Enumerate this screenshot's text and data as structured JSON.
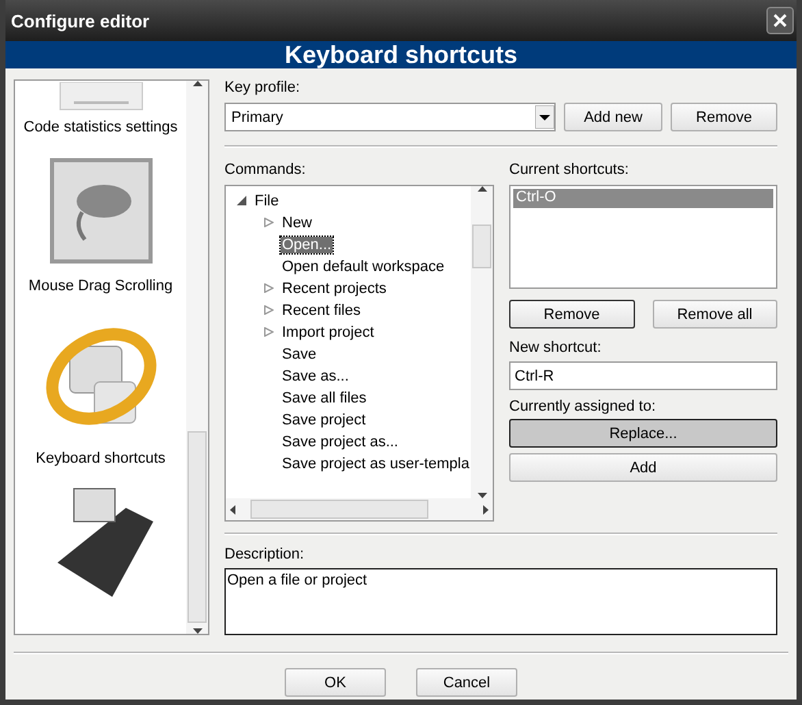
{
  "window": {
    "title": "Configure editor"
  },
  "header": "Keyboard shortcuts",
  "sidebar": {
    "items": [
      {
        "label": "Code statistics settings"
      },
      {
        "label": "Mouse Drag Scrolling"
      },
      {
        "label": "Keyboard shortcuts"
      }
    ]
  },
  "key_profile": {
    "label": "Key profile:",
    "value": "Primary",
    "buttons": [
      "Add new",
      "Remove"
    ]
  },
  "commands": {
    "label": "Commands:",
    "tree": [
      {
        "label": "File",
        "kind": "branch",
        "expanded": true,
        "selected": false,
        "children": [
          {
            "label": "New",
            "kind": "branch",
            "expanded": false,
            "selected": false
          },
          {
            "label": "Open...",
            "kind": "leaf",
            "selected": true
          },
          {
            "label": "Open default workspace",
            "kind": "leaf",
            "selected": false
          },
          {
            "label": "Recent projects",
            "kind": "branch",
            "expanded": false,
            "selected": false
          },
          {
            "label": "Recent files",
            "kind": "branch",
            "expanded": false,
            "selected": false
          },
          {
            "label": "Import project",
            "kind": "branch",
            "expanded": false,
            "selected": false
          },
          {
            "label": "Save",
            "kind": "leaf",
            "selected": false
          },
          {
            "label": "Save as...",
            "kind": "leaf",
            "selected": false
          },
          {
            "label": "Save all files",
            "kind": "leaf",
            "selected": false
          },
          {
            "label": "Save project",
            "kind": "leaf",
            "selected": false
          },
          {
            "label": "Save project as...",
            "kind": "leaf",
            "selected": false
          },
          {
            "label": "Save project as user-templa",
            "kind": "leaf",
            "selected": false
          }
        ]
      }
    ]
  },
  "current_shortcuts": {
    "label": "Current shortcuts:",
    "items": [
      {
        "label": "Ctrl-O",
        "selected": true
      }
    ],
    "buttons": [
      "Remove",
      "Remove all"
    ]
  },
  "new_shortcut": {
    "label": "New shortcut:",
    "value": "Ctrl-R"
  },
  "assigned": {
    "label": "Currently assigned to:",
    "button": "Replace...",
    "disabled": true
  },
  "add_button": "Add",
  "description": {
    "label": "Description:",
    "value": "Open a file or project"
  },
  "footer_buttons": [
    "OK",
    "Cancel"
  ]
}
